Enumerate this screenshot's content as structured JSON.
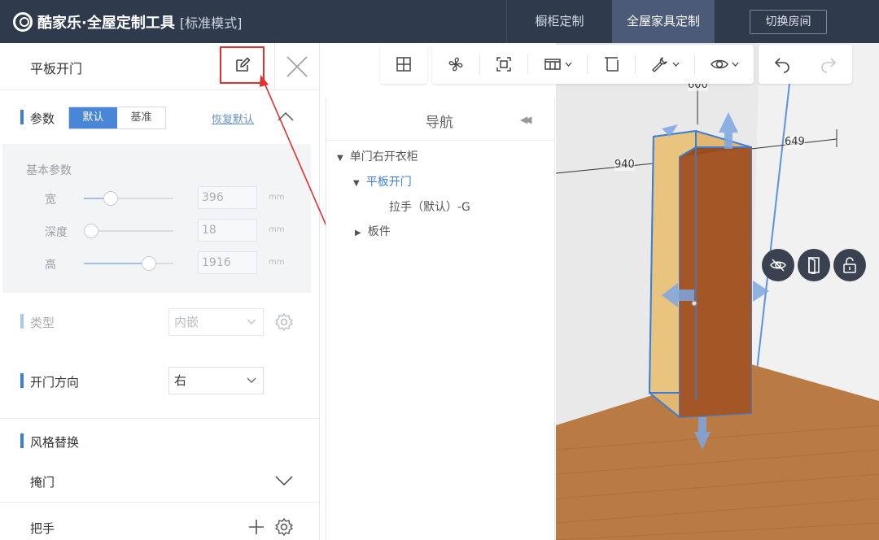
{
  "app": {
    "name": "酷家乐·全屋定制工具",
    "mode": "[标准模式]"
  },
  "top_tabs": [
    {
      "label": "橱柜定制"
    },
    {
      "label": "全屋家具定制"
    }
  ],
  "switch_room": "切换房间",
  "panel": {
    "title": "平板开门",
    "params_label": "参数",
    "seg_default": "默认",
    "seg_base": "基准",
    "restore_default": "恢复默认",
    "basic_params_title": "基本参数",
    "params": [
      {
        "name": "宽",
        "value": "396",
        "unit": "mm",
        "level": 0.3
      },
      {
        "name": "深度",
        "value": "18",
        "unit": "mm",
        "level": 0.08
      },
      {
        "name": "高",
        "value": "1916",
        "unit": "mm",
        "level": 0.73
      }
    ],
    "type_label": "类型",
    "type_value": "内嵌",
    "door_dir_label": "开门方向",
    "door_dir_value": "右",
    "style_label": "风格替换",
    "cover_door_label": "掩门",
    "handle_label": "把手"
  },
  "nav": {
    "title": "导航",
    "tree": [
      {
        "label": "单门右开衣柜",
        "expanded": true
      },
      {
        "label": "平板开门",
        "expanded": true,
        "selected": true
      },
      {
        "label": "拉手（默认）-G"
      },
      {
        "label": "板件",
        "expanded": false
      }
    ]
  },
  "toolbar_icons": [
    "grid-icon",
    "fan-icon",
    "frame-icon",
    "columns-icon",
    "panel-icon",
    "wrench-icon",
    "eye-icon",
    "undo-icon",
    "redo-icon"
  ],
  "dimensions": {
    "top": "600",
    "left": "940",
    "right": "649"
  },
  "colors": {
    "topbar": "#2f3a4d",
    "accent": "#3d7fd6",
    "highlight": "#e0312f"
  }
}
